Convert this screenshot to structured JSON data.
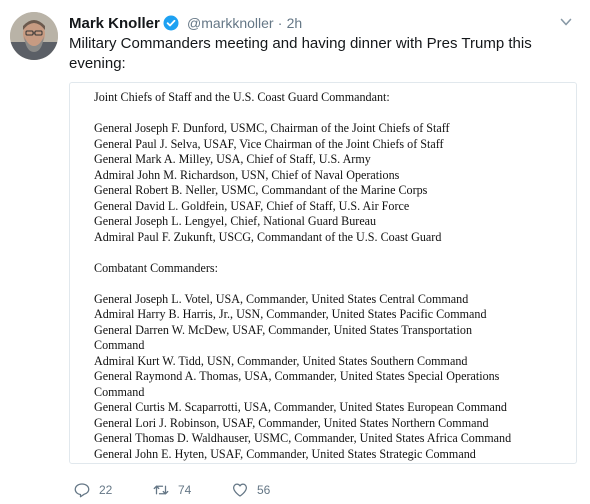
{
  "tweet": {
    "author_name": "Mark Knoller",
    "handle": "@markknoller",
    "separator": "·",
    "time": "2h",
    "text": "Military Commanders meeting and having dinner with Pres Trump this evening:",
    "image_text": {
      "heading1": "Joint Chiefs of Staff and the U.S. Coast Guard Commandant:",
      "group1": [
        "General Joseph F. Dunford, USMC, Chairman of the Joint Chiefs of Staff",
        "General Paul J. Selva, USAF, Vice Chairman of the Joint Chiefs of Staff",
        "General Mark A. Milley, USA, Chief of Staff, U.S. Army",
        "Admiral John M. Richardson, USN, Chief of Naval Operations",
        "General Robert B. Neller, USMC, Commandant of the Marine Corps",
        "General David L. Goldfein, USAF, Chief of Staff, U.S. Air Force",
        "General Joseph L. Lengyel, Chief, National Guard Bureau",
        "Admiral Paul F. Zukunft, USCG, Commandant of the U.S. Coast Guard"
      ],
      "heading2": "Combatant Commanders:",
      "group2": [
        "General Joseph L. Votel, USA, Commander, United States Central Command",
        "Admiral Harry B. Harris, Jr., USN, Commander, United States Pacific Command",
        "General Darren W. McDew, USAF, Commander, United States Transportation",
        "Command",
        "Admiral Kurt W. Tidd, USN, Commander, United States Southern Command",
        "General Raymond A. Thomas, USA, Commander, United States Special Operations",
        "Command",
        "General Curtis M. Scaparrotti, USA, Commander, United States European Command",
        "General Lori J. Robinson, USAF, Commander, United States Northern Command",
        "General Thomas D. Waldhauser, USMC, Commander, United States Africa Command",
        "General John E. Hyten, USAF, Commander, United States Strategic Command"
      ]
    },
    "actions": {
      "replies": "22",
      "retweets": "74",
      "likes": "56"
    }
  },
  "icons": {
    "verified": "verified-badge-icon",
    "caret": "chevron-down-icon",
    "reply": "reply-icon",
    "retweet": "retweet-icon",
    "like": "heart-icon"
  },
  "colors": {
    "verified_blue": "#1da1f2",
    "secondary_text": "#657786",
    "retweet_green": "#17bf63"
  }
}
